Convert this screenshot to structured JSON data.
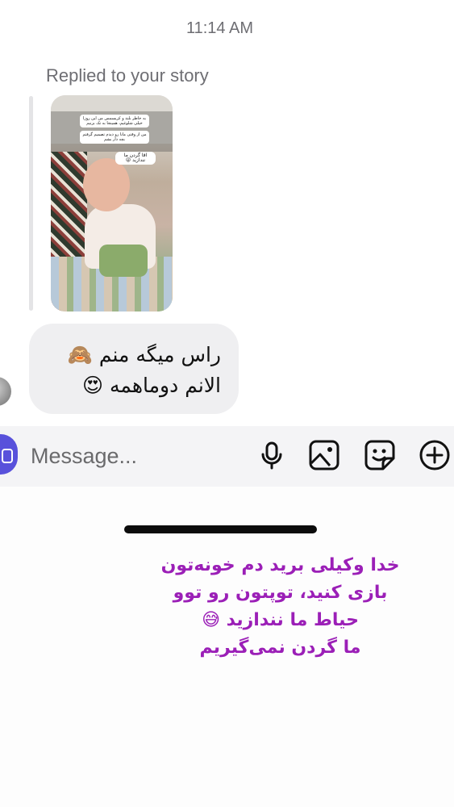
{
  "timestamp": "11:14 AM",
  "reply_label": "Replied to your story",
  "story": {
    "sticker_1": "به خاطر بلند و کریسمس من این روزا خیلی شلوغیم، همینجا به تک بزنیم",
    "sticker_2": "من از وقتی مانا رو دیدم تصمیم گرفتم بچه دار بشم",
    "sticker_3": "اقا گردن ما نندازید 😜"
  },
  "message": {
    "line1": "راس میگه منم 🙈",
    "line2": "الانم دوماهمه 😍"
  },
  "composer": {
    "placeholder": "Message..."
  },
  "caption": {
    "line1": "خدا وکیلی برید دم خونه‌تون",
    "line2": "بازی کنید، توپتون رو توو",
    "line3": "حیاط ما نندازید 😅",
    "line4": "ما گردن نمی‌گیریم"
  },
  "colors": {
    "caption": "#9b1fb7",
    "bubble": "#efeff1",
    "accent": "#5851db"
  }
}
